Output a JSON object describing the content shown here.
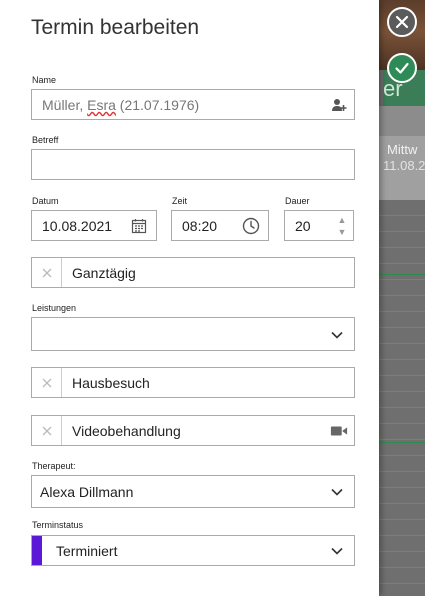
{
  "backdrop": {
    "green_text": "er",
    "day_name": "Mittw",
    "day_date": "11.08.2"
  },
  "form": {
    "title": "Termin bearbeiten",
    "name_label": "Name",
    "name_value_surname": "Müller, ",
    "name_value_firstname": "Esra",
    "name_value_birth": " (21.07.1976)",
    "subject_label": "Betreff",
    "subject_value": "",
    "date_label": "Datum",
    "date_value": "10.08.2021",
    "time_label": "Zeit",
    "time_value": "08:20",
    "duration_label": "Dauer",
    "duration_value": "20",
    "all_day_label": "Ganztägig",
    "services_label": "Leistungen",
    "services_value": "",
    "home_visit_label": "Hausbesuch",
    "video_label": "Videobehandlung",
    "therapist_label": "Therapeut:",
    "therapist_value": "Alexa Dillmann",
    "status_label": "Terminstatus",
    "status_value": "Terminiert",
    "status_color": "#5b19d7"
  },
  "icons": {
    "close": "close-icon",
    "save": "check-icon",
    "add_person": "add-person-icon",
    "calendar": "calendar-icon",
    "clock": "clock-icon",
    "chevron": "chevron-down-icon",
    "video": "video-camera-icon",
    "toggle_off": "x-icon"
  }
}
